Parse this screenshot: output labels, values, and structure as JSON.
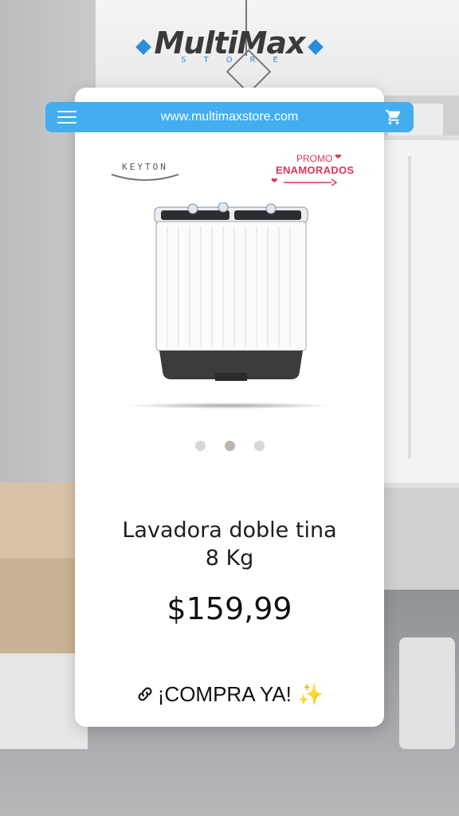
{
  "logo": {
    "name": "MultiMax",
    "sub": "STORE"
  },
  "urlbar": {
    "url": "www.multimaxstore.com"
  },
  "brand": {
    "name": "KEYTON"
  },
  "promo": {
    "top": "PROMO",
    "main": "ENAMORADOS"
  },
  "carousel": {
    "count": 3,
    "active_index": 1
  },
  "product": {
    "title_line1": "Lavadora doble tina",
    "title_line2": "8 Kg",
    "price": "$159,99"
  },
  "cta": {
    "label": "¡COMPRA YA!",
    "sparkle": "✨"
  },
  "colors": {
    "accent": "#42aef0",
    "promo": "#e0355a",
    "card": "#ffffff"
  },
  "icons": [
    "menu-icon",
    "cart-icon",
    "link-icon",
    "sparkle-icon",
    "logo-diamond-icon"
  ]
}
